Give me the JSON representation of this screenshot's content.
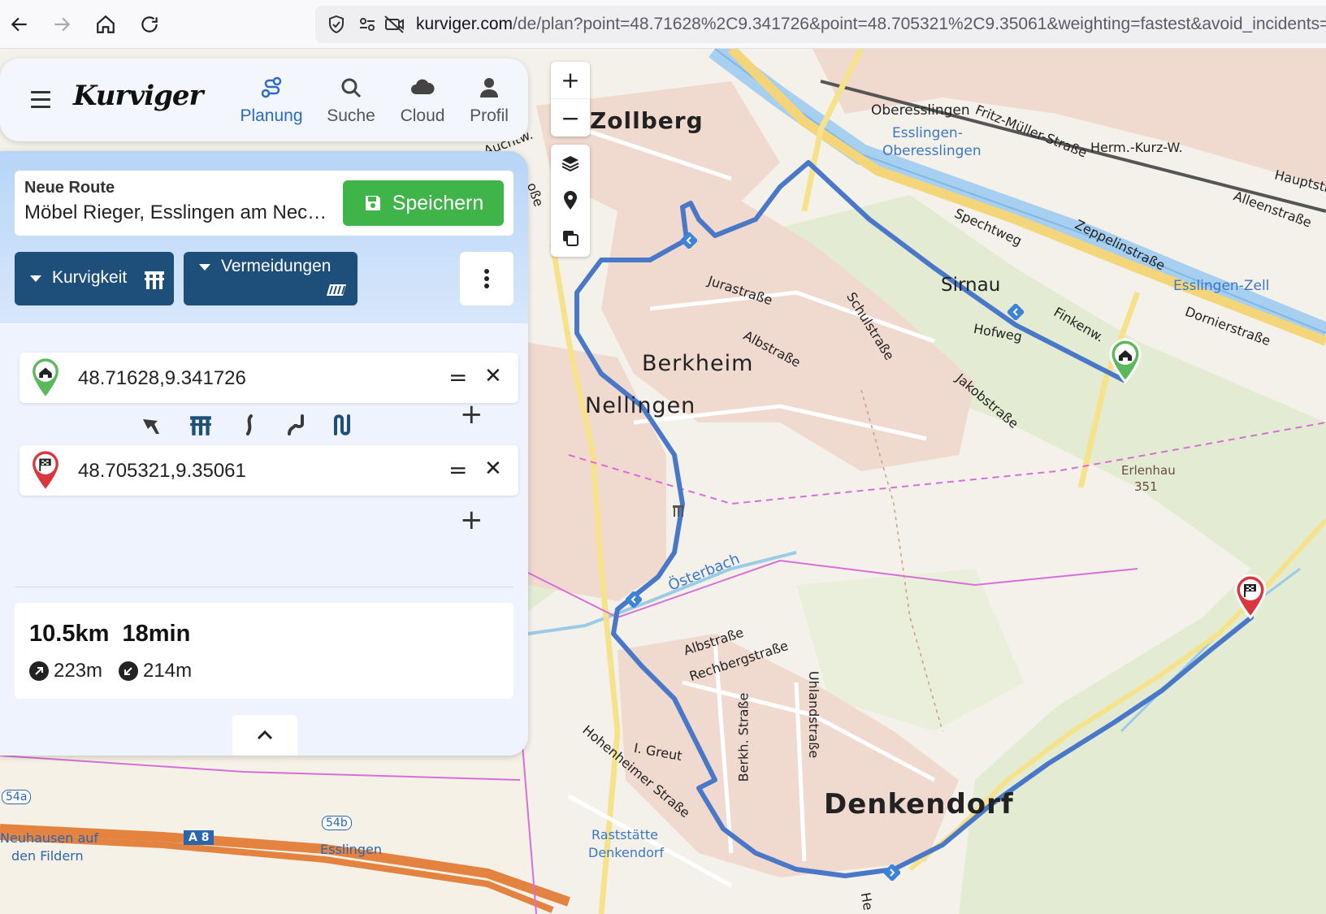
{
  "browser": {
    "url_host": "kurviger.com",
    "url_path": "/de/plan?point=48.71628%2C9.341726&point=48.705321%2C9.35061&weighting=fastest&avoid_incidents=t"
  },
  "app": {
    "logo": "Kurviger",
    "nav": [
      {
        "label": "Planung",
        "icon": "route-icon"
      },
      {
        "label": "Suche",
        "icon": "search-icon"
      },
      {
        "label": "Cloud",
        "icon": "cloud-icon"
      },
      {
        "label": "Profil",
        "icon": "user-icon"
      }
    ]
  },
  "route": {
    "title": "Neue Route",
    "name": "Möbel Rieger, Esslingen am Neckar",
    "save_label": "Speichern",
    "curviness_label": "Kurvigkeit",
    "avoid_label": "Vermeidungen"
  },
  "waypoints": [
    {
      "value": "48.71628,9.341726",
      "type": "start"
    },
    {
      "value": "48.705321,9.35061",
      "type": "finish"
    }
  ],
  "stats": {
    "distance": "10.5km",
    "duration": "18min",
    "ascent": "223m",
    "descent": "214m"
  },
  "map_labels": {
    "zollberg": "Zollberg",
    "oberesslingen": "Oberesslingen",
    "esslingen_ob1": "Esslingen-",
    "esslingen_ob2": "Oberesslingen",
    "fritz": "Fritz-Müller-Straße",
    "herm": "Herm.-Kurz-W.",
    "hauptstr": "Hauptstr.",
    "alleenstrasse": "Alleenstraße",
    "spechtweg": "Spechtweg",
    "zeppelin": "Zeppelinstraße",
    "sirnau": "Sirnau",
    "esslingen_zell": "Esslingen-Zell",
    "dornier": "Dornierstraße",
    "finkenw": "Finkenw.",
    "hofweg": "Hofweg",
    "jura": "Jurastraße",
    "schul": "Schulstraße",
    "alb1": "Albstraße",
    "berkheim": "Berkheim",
    "nellingen": "Nellingen",
    "jakob": "Jakobstraße",
    "erlenhau": "Erlenhau",
    "erlenhau_h": "351",
    "osterbach": "Österbach",
    "alb2": "Albstraße",
    "rechberg": "Rechbergstraße",
    "uhland": "Uhlandstraße",
    "berkh": "Berkh. Straße",
    "greut": "I. Greut",
    "hohenheimer": "Hohenheimer Straße",
    "raststaette1": "Raststätte",
    "raststaette2": "Denkendorf",
    "denkendorf": "Denkendorf",
    "a8": "A 8",
    "j54a": "54a",
    "j54b": "54b",
    "neuhausen1": "Neuhausen auf",
    "neuhausen2": "den Fildern",
    "esslingen_exit": "Esslingen",
    "auchtw": "Auchtw.",
    "osse": "oße",
    "hei": "He"
  },
  "colors": {
    "route": "#4a78c8",
    "accent": "#2d6ac7",
    "save": "#3fb449",
    "dark_button": "#1e4f7a",
    "start_pin": "#5cb85c",
    "finish_pin": "#d9363e"
  }
}
